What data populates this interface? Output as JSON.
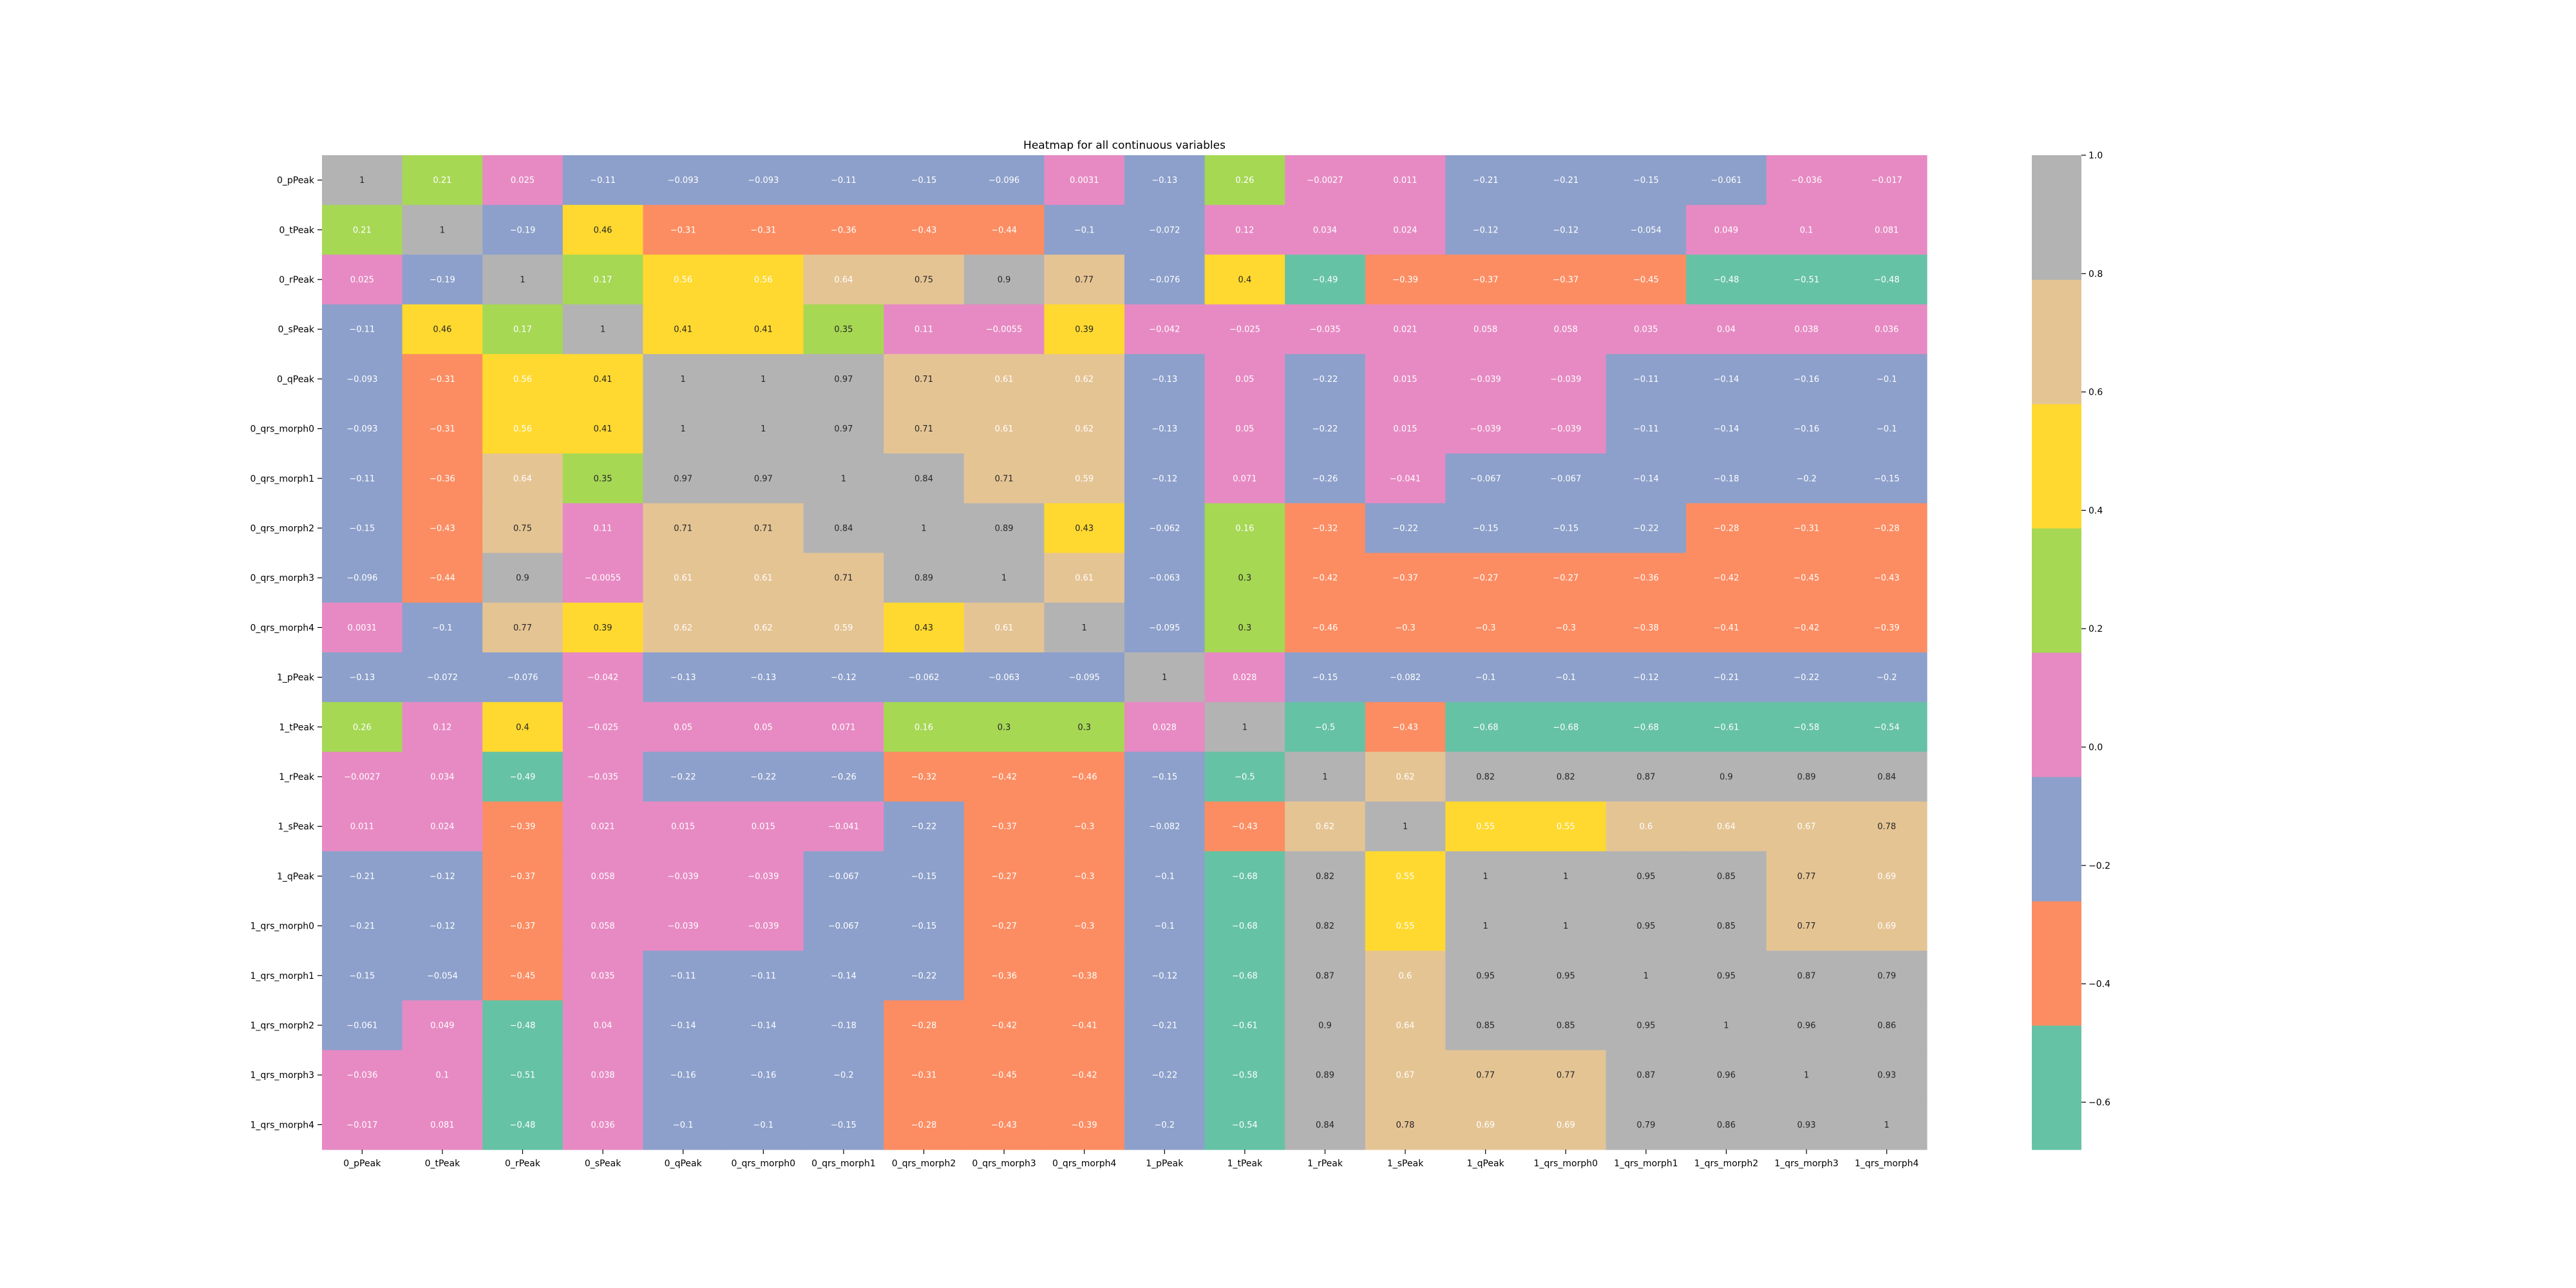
{
  "chart_data": {
    "type": "heatmap",
    "title": "Heatmap for all continuous variables",
    "x_labels": [
      "0_pPeak",
      "0_tPeak",
      "0_rPeak",
      "0_sPeak",
      "0_qPeak",
      "0_qrs_morph0",
      "0_qrs_morph1",
      "0_qrs_morph2",
      "0_qrs_morph3",
      "0_qrs_morph4",
      "1_pPeak",
      "1_tPeak",
      "1_rPeak",
      "1_sPeak",
      "1_qPeak",
      "1_qrs_morph0",
      "1_qrs_morph1",
      "1_qrs_morph2",
      "1_qrs_morph3",
      "1_qrs_morph4"
    ],
    "y_labels": [
      "0_pPeak",
      "0_tPeak",
      "0_rPeak",
      "0_sPeak",
      "0_qPeak",
      "0_qrs_morph0",
      "0_qrs_morph1",
      "0_qrs_morph2",
      "0_qrs_morph3",
      "0_qrs_morph4",
      "1_pPeak",
      "1_tPeak",
      "1_rPeak",
      "1_sPeak",
      "1_qPeak",
      "1_qrs_morph0",
      "1_qrs_morph1",
      "1_qrs_morph2",
      "1_qrs_morph3",
      "1_qrs_morph4"
    ],
    "values": [
      [
        1,
        0.21,
        0.025,
        -0.11,
        -0.093,
        -0.093,
        -0.11,
        -0.15,
        -0.096,
        0.0031,
        -0.13,
        0.26,
        -0.0027,
        0.011,
        -0.21,
        -0.21,
        -0.15,
        -0.061,
        -0.036,
        -0.017
      ],
      [
        0.21,
        1,
        -0.19,
        0.46,
        -0.31,
        -0.31,
        -0.36,
        -0.43,
        -0.44,
        -0.1,
        -0.072,
        0.12,
        0.034,
        0.024,
        -0.12,
        -0.12,
        -0.054,
        0.049,
        0.1,
        0.081
      ],
      [
        0.025,
        -0.19,
        1,
        0.17,
        0.56,
        0.56,
        0.64,
        0.75,
        0.9,
        0.77,
        -0.076,
        0.4,
        -0.49,
        -0.39,
        -0.37,
        -0.37,
        -0.45,
        -0.48,
        -0.51,
        -0.48
      ],
      [
        -0.11,
        0.46,
        0.17,
        1,
        0.41,
        0.41,
        0.35,
        0.11,
        -0.0055,
        0.39,
        -0.042,
        -0.025,
        -0.035,
        0.021,
        0.058,
        0.058,
        0.035,
        0.04,
        0.038,
        0.036
      ],
      [
        -0.093,
        -0.31,
        0.56,
        0.41,
        1,
        1,
        0.97,
        0.71,
        0.61,
        0.62,
        -0.13,
        0.05,
        -0.22,
        0.015,
        -0.039,
        -0.039,
        -0.11,
        -0.14,
        -0.16,
        -0.1
      ],
      [
        -0.093,
        -0.31,
        0.56,
        0.41,
        1,
        1,
        0.97,
        0.71,
        0.61,
        0.62,
        -0.13,
        0.05,
        -0.22,
        0.015,
        -0.039,
        -0.039,
        -0.11,
        -0.14,
        -0.16,
        -0.1
      ],
      [
        -0.11,
        -0.36,
        0.64,
        0.35,
        0.97,
        0.97,
        1,
        0.84,
        0.71,
        0.59,
        -0.12,
        0.071,
        -0.26,
        -0.041,
        -0.067,
        -0.067,
        -0.14,
        -0.18,
        -0.2,
        -0.15
      ],
      [
        -0.15,
        -0.43,
        0.75,
        0.11,
        0.71,
        0.71,
        0.84,
        1,
        0.89,
        0.43,
        -0.062,
        0.16,
        -0.32,
        -0.22,
        -0.15,
        -0.15,
        -0.22,
        -0.28,
        -0.31,
        -0.28
      ],
      [
        -0.096,
        -0.44,
        0.9,
        -0.0055,
        0.61,
        0.61,
        0.71,
        0.89,
        1,
        0.61,
        -0.063,
        0.3,
        -0.42,
        -0.37,
        -0.27,
        -0.27,
        -0.36,
        -0.42,
        -0.45,
        -0.43
      ],
      [
        0.0031,
        -0.1,
        0.77,
        0.39,
        0.62,
        0.62,
        0.59,
        0.43,
        0.61,
        1,
        -0.095,
        0.3,
        -0.46,
        -0.3,
        -0.3,
        -0.3,
        -0.38,
        -0.41,
        -0.42,
        -0.39
      ],
      [
        -0.13,
        -0.072,
        -0.076,
        -0.042,
        -0.13,
        -0.13,
        -0.12,
        -0.062,
        -0.063,
        -0.095,
        1,
        0.028,
        -0.15,
        -0.082,
        -0.1,
        -0.1,
        -0.12,
        -0.21,
        -0.22,
        -0.2
      ],
      [
        0.26,
        0.12,
        0.4,
        -0.025,
        0.05,
        0.05,
        0.071,
        0.16,
        0.3,
        0.3,
        0.028,
        1,
        -0.5,
        -0.43,
        -0.68,
        -0.68,
        -0.68,
        -0.61,
        -0.58,
        -0.54
      ],
      [
        -0.0027,
        0.034,
        -0.49,
        -0.035,
        -0.22,
        -0.22,
        -0.26,
        -0.32,
        -0.42,
        -0.46,
        -0.15,
        -0.5,
        1,
        0.62,
        0.82,
        0.82,
        0.87,
        0.9,
        0.89,
        0.84
      ],
      [
        0.011,
        0.024,
        -0.39,
        0.021,
        0.015,
        0.015,
        -0.041,
        -0.22,
        -0.37,
        -0.3,
        -0.082,
        -0.43,
        0.62,
        1,
        0.55,
        0.55,
        0.6,
        0.64,
        0.67,
        0.78
      ],
      [
        -0.21,
        -0.12,
        -0.37,
        0.058,
        -0.039,
        -0.039,
        -0.067,
        -0.15,
        -0.27,
        -0.3,
        -0.1,
        -0.68,
        0.82,
        0.55,
        1,
        1,
        0.95,
        0.85,
        0.77,
        0.69
      ],
      [
        -0.21,
        -0.12,
        -0.37,
        0.058,
        -0.039,
        -0.039,
        -0.067,
        -0.15,
        -0.27,
        -0.3,
        -0.1,
        -0.68,
        0.82,
        0.55,
        1,
        1,
        0.95,
        0.85,
        0.77,
        0.69
      ],
      [
        -0.15,
        -0.054,
        -0.45,
        0.035,
        -0.11,
        -0.11,
        -0.14,
        -0.22,
        -0.36,
        -0.38,
        -0.12,
        -0.68,
        0.87,
        0.6,
        0.95,
        0.95,
        1,
        0.95,
        0.87,
        0.79
      ],
      [
        -0.061,
        0.049,
        -0.48,
        0.04,
        -0.14,
        -0.14,
        -0.18,
        -0.28,
        -0.42,
        -0.41,
        -0.21,
        -0.61,
        0.9,
        0.64,
        0.85,
        0.85,
        0.95,
        1,
        0.96,
        0.86
      ],
      [
        -0.036,
        0.1,
        -0.51,
        0.038,
        -0.16,
        -0.16,
        -0.2,
        -0.31,
        -0.45,
        -0.42,
        -0.22,
        -0.58,
        0.89,
        0.67,
        0.77,
        0.77,
        0.87,
        0.96,
        1,
        0.93
      ],
      [
        -0.017,
        0.081,
        -0.48,
        0.036,
        -0.1,
        -0.1,
        -0.15,
        -0.28,
        -0.43,
        -0.39,
        -0.2,
        -0.54,
        0.84,
        0.78,
        0.69,
        0.69,
        0.79,
        0.86,
        0.93,
        1
      ]
    ],
    "colorbar": {
      "vmin": -0.68,
      "vmax": 1.0,
      "ticks": [
        -0.6,
        -0.4,
        -0.2,
        0.0,
        0.2,
        0.4,
        0.6,
        0.8,
        1.0
      ],
      "tick_labels": [
        "−0.6",
        "−0.4",
        "−0.2",
        "0.0",
        "0.2",
        "0.4",
        "0.6",
        "0.8",
        "1.0"
      ],
      "palette": [
        "#66c2a5",
        "#fc8d62",
        "#8da0cb",
        "#e78ac3",
        "#a6d854",
        "#ffd92f",
        "#e5c494",
        "#b3b3b3"
      ]
    },
    "annotations": true,
    "grid": false
  }
}
